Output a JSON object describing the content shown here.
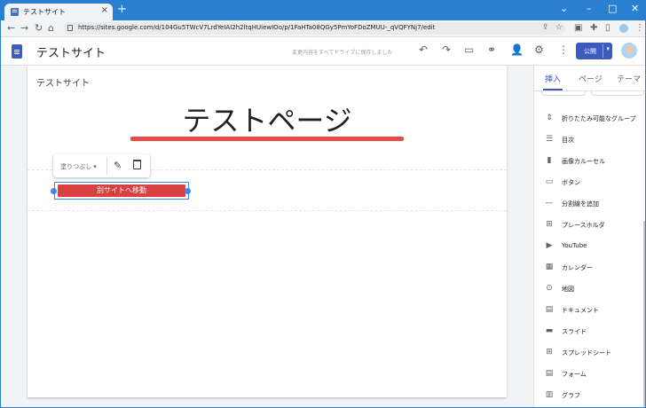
{
  "browser": {
    "tab_title": "テストサイト",
    "url": "https://sites.google.com/d/104Gu5TWcV7LrdYeIAI2h2ltqHUiewIOo/p/1FaHTa08QGy5PmYoFDoZMUU-_qVQFYNj7/edit"
  },
  "app": {
    "site_name": "テストサイト",
    "saved_message": "変更内容をすべてドライブに保存しました",
    "publish_label": "公開"
  },
  "page": {
    "site_label": "テストサイト",
    "heading": "テストページ",
    "toolbar_fill_label": "塗りつぶし",
    "button_label": "別サイトへ移動"
  },
  "colors": {
    "accent": "#3c5bbd",
    "button_fill": "#d94040",
    "underline": "#e84a4a",
    "selection": "#4285f4"
  },
  "panel": {
    "tabs": [
      "挿入",
      "ページ",
      "テーマ"
    ],
    "items": [
      {
        "label": "折りたたみ可能なグループ",
        "icon": "collapsible-group-icon"
      },
      {
        "label": "目次",
        "icon": "table-of-contents-icon"
      },
      {
        "label": "画像カルーセル",
        "icon": "image-carousel-icon"
      },
      {
        "label": "ボタン",
        "icon": "button-icon"
      },
      {
        "label": "分割線を追加",
        "icon": "divider-icon"
      },
      {
        "label": "プレースホルダ",
        "icon": "placeholder-icon"
      },
      {
        "label": "YouTube",
        "icon": "youtube-icon"
      },
      {
        "label": "カレンダー",
        "icon": "calendar-icon"
      },
      {
        "label": "地図",
        "icon": "map-pin-icon"
      },
      {
        "label": "ドキュメント",
        "icon": "docs-icon"
      },
      {
        "label": "スライド",
        "icon": "slides-icon"
      },
      {
        "label": "スプレッドシート",
        "icon": "sheets-icon"
      },
      {
        "label": "フォーム",
        "icon": "forms-icon"
      },
      {
        "label": "グラフ",
        "icon": "chart-icon"
      }
    ]
  }
}
